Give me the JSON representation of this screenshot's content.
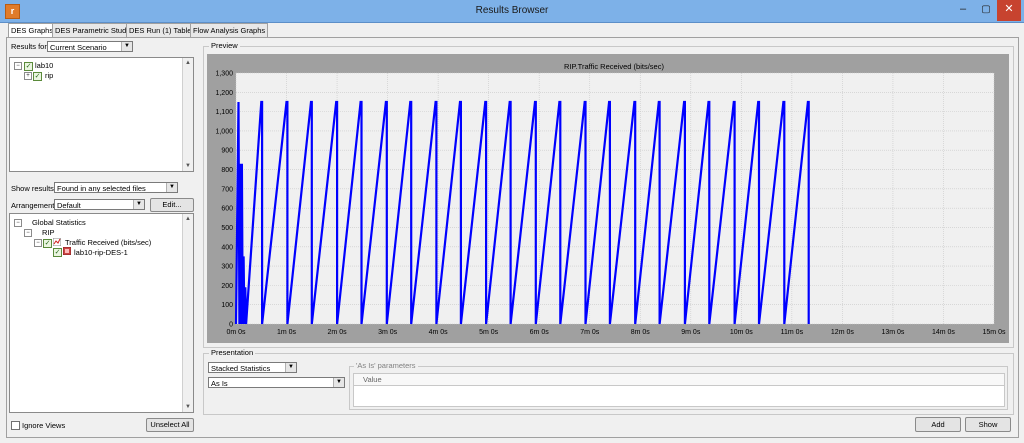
{
  "app": {
    "icon_letter": "r",
    "window_title": "Results Browser"
  },
  "window_buttons": {
    "minimize": "–",
    "maximize": "▢",
    "close": "✕"
  },
  "tabs": [
    "DES Graphs",
    "DES Parametric Studies",
    "DES Run (1) Tables",
    "Flow Analysis Graphs"
  ],
  "left": {
    "results_for_label": "Results for:",
    "results_for_value": "Current Scenario",
    "project_tree": {
      "root": "lab10",
      "child": "rip"
    },
    "show_results_label": "Show results:",
    "show_results_value": "Found in any selected files",
    "arrangement_label": "Arrangement:",
    "arrangement_value": "Default",
    "edit_button": "Edit...",
    "stats_tree": {
      "root": "Global Statistics",
      "group": "RIP",
      "stat": "Traffic Received (bits/sec)",
      "run": "lab10-rip-DES-1"
    },
    "ignore_views_label": "Ignore Views",
    "unselect_all_button": "Unselect All"
  },
  "preview": {
    "label": "Preview",
    "chart_title": "RIP.Traffic Received (bits/sec)"
  },
  "presentation": {
    "label": "Presentation",
    "mode_value": "Stacked Statistics",
    "filter_value": "As Is",
    "params_label": "'As Is' parameters",
    "params_column": "Value"
  },
  "buttons": {
    "add": "Add",
    "show": "Show"
  },
  "colors": {
    "series": "#0000ff",
    "plot_bg": "#f0f0f0",
    "plot_frame": "#a0a0a0",
    "titlebar": "#7db1e8",
    "close_button": "#c7432f"
  },
  "chart_data": {
    "type": "line",
    "title": "RIP.Traffic Received (bits/sec)",
    "xlabel": "",
    "ylabel": "",
    "x_unit": "seconds",
    "xlim": [
      0,
      900
    ],
    "ylim": [
      0,
      1300
    ],
    "x_ticks": [
      "0m 0s",
      "1m 0s",
      "2m 0s",
      "3m 0s",
      "4m 0s",
      "5m 0s",
      "6m 0s",
      "7m 0s",
      "8m 0s",
      "9m 0s",
      "10m 0s",
      "11m 0s",
      "12m 0s",
      "13m 0s",
      "14m 0s",
      "15m 0s"
    ],
    "y_ticks": [
      "0",
      "100",
      "200",
      "300",
      "400",
      "500",
      "600",
      "700",
      "800",
      "900",
      "1,000",
      "1,100",
      "1,200",
      "1,300"
    ],
    "grid": true,
    "legend": "none",
    "series": [
      {
        "points": [
          [
            0,
            0
          ],
          [
            3,
            1150
          ],
          [
            4,
            0
          ],
          [
            5,
            830
          ],
          [
            6,
            0
          ],
          [
            7,
            830
          ],
          [
            8,
            0
          ],
          [
            9,
            350
          ],
          [
            10,
            0
          ],
          [
            11,
            190
          ],
          [
            12,
            0
          ],
          [
            30,
            1150
          ],
          [
            31,
            1150
          ],
          [
            31,
            0
          ],
          [
            60,
            1150
          ],
          [
            61,
            1150
          ],
          [
            61,
            0
          ],
          [
            89,
            1150
          ],
          [
            90,
            1150
          ],
          [
            90,
            0
          ],
          [
            119,
            1150
          ],
          [
            120,
            1150
          ],
          [
            120,
            0
          ],
          [
            148,
            1150
          ],
          [
            149,
            1150
          ],
          [
            149,
            0
          ],
          [
            178,
            1150
          ],
          [
            179,
            1150
          ],
          [
            179,
            0
          ],
          [
            207,
            1150
          ],
          [
            208,
            1150
          ],
          [
            208,
            0
          ],
          [
            237,
            1150
          ],
          [
            238,
            1150
          ],
          [
            238,
            0
          ],
          [
            266,
            1150
          ],
          [
            267,
            1150
          ],
          [
            267,
            0
          ],
          [
            296,
            1150
          ],
          [
            297,
            1150
          ],
          [
            297,
            0
          ],
          [
            325,
            1150
          ],
          [
            326,
            1150
          ],
          [
            326,
            0
          ],
          [
            355,
            1150
          ],
          [
            356,
            1150
          ],
          [
            356,
            0
          ],
          [
            384,
            1150
          ],
          [
            385,
            1150
          ],
          [
            385,
            0
          ],
          [
            414,
            1150
          ],
          [
            415,
            1150
          ],
          [
            415,
            0
          ],
          [
            443,
            1150
          ],
          [
            444,
            1150
          ],
          [
            444,
            0
          ],
          [
            473,
            1150
          ],
          [
            474,
            1150
          ],
          [
            474,
            0
          ],
          [
            502,
            1150
          ],
          [
            503,
            1150
          ],
          [
            503,
            0
          ],
          [
            532,
            1150
          ],
          [
            533,
            1150
          ],
          [
            533,
            0
          ],
          [
            561,
            1150
          ],
          [
            562,
            1150
          ],
          [
            562,
            0
          ],
          [
            591,
            1150
          ],
          [
            592,
            1150
          ],
          [
            592,
            0
          ],
          [
            620,
            1150
          ],
          [
            621,
            1150
          ],
          [
            621,
            0
          ],
          [
            650,
            1150
          ],
          [
            651,
            1150
          ],
          [
            651,
            0
          ],
          [
            679,
            1150
          ],
          [
            680,
            1150
          ],
          [
            680,
            0
          ]
        ]
      }
    ]
  }
}
